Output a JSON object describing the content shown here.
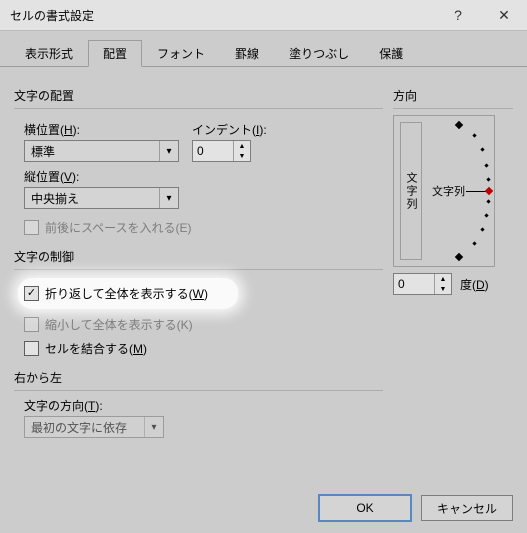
{
  "title": "セルの書式設定",
  "tabs": [
    "表示形式",
    "配置",
    "フォント",
    "罫線",
    "塗りつぶし",
    "保護"
  ],
  "active_tab": 1,
  "text_alignment": {
    "legend": "文字の配置",
    "horizontal_label": "横位置(H):",
    "horizontal_value": "標準",
    "vertical_label": "縦位置(V):",
    "vertical_value": "中央揃え",
    "indent_label": "インデント(I):",
    "indent_value": "0",
    "distribute_label": "前後にスペースを入れる(E)"
  },
  "text_control": {
    "legend": "文字の制御",
    "wrap_label": "折り返して全体を表示する(W)",
    "shrink_label": "縮小して全体を表示する(K)",
    "merge_label": "セルを結合する(M)"
  },
  "rtl": {
    "legend": "右から左",
    "direction_label": "文字の方向(T):",
    "direction_value": "最初の文字に依存"
  },
  "orientation": {
    "legend": "方向",
    "vertical_text": "文字列",
    "label_text": "文字列",
    "degrees_value": "0",
    "degrees_label": "度(D)"
  },
  "buttons": {
    "ok": "OK",
    "cancel": "キャンセル"
  }
}
